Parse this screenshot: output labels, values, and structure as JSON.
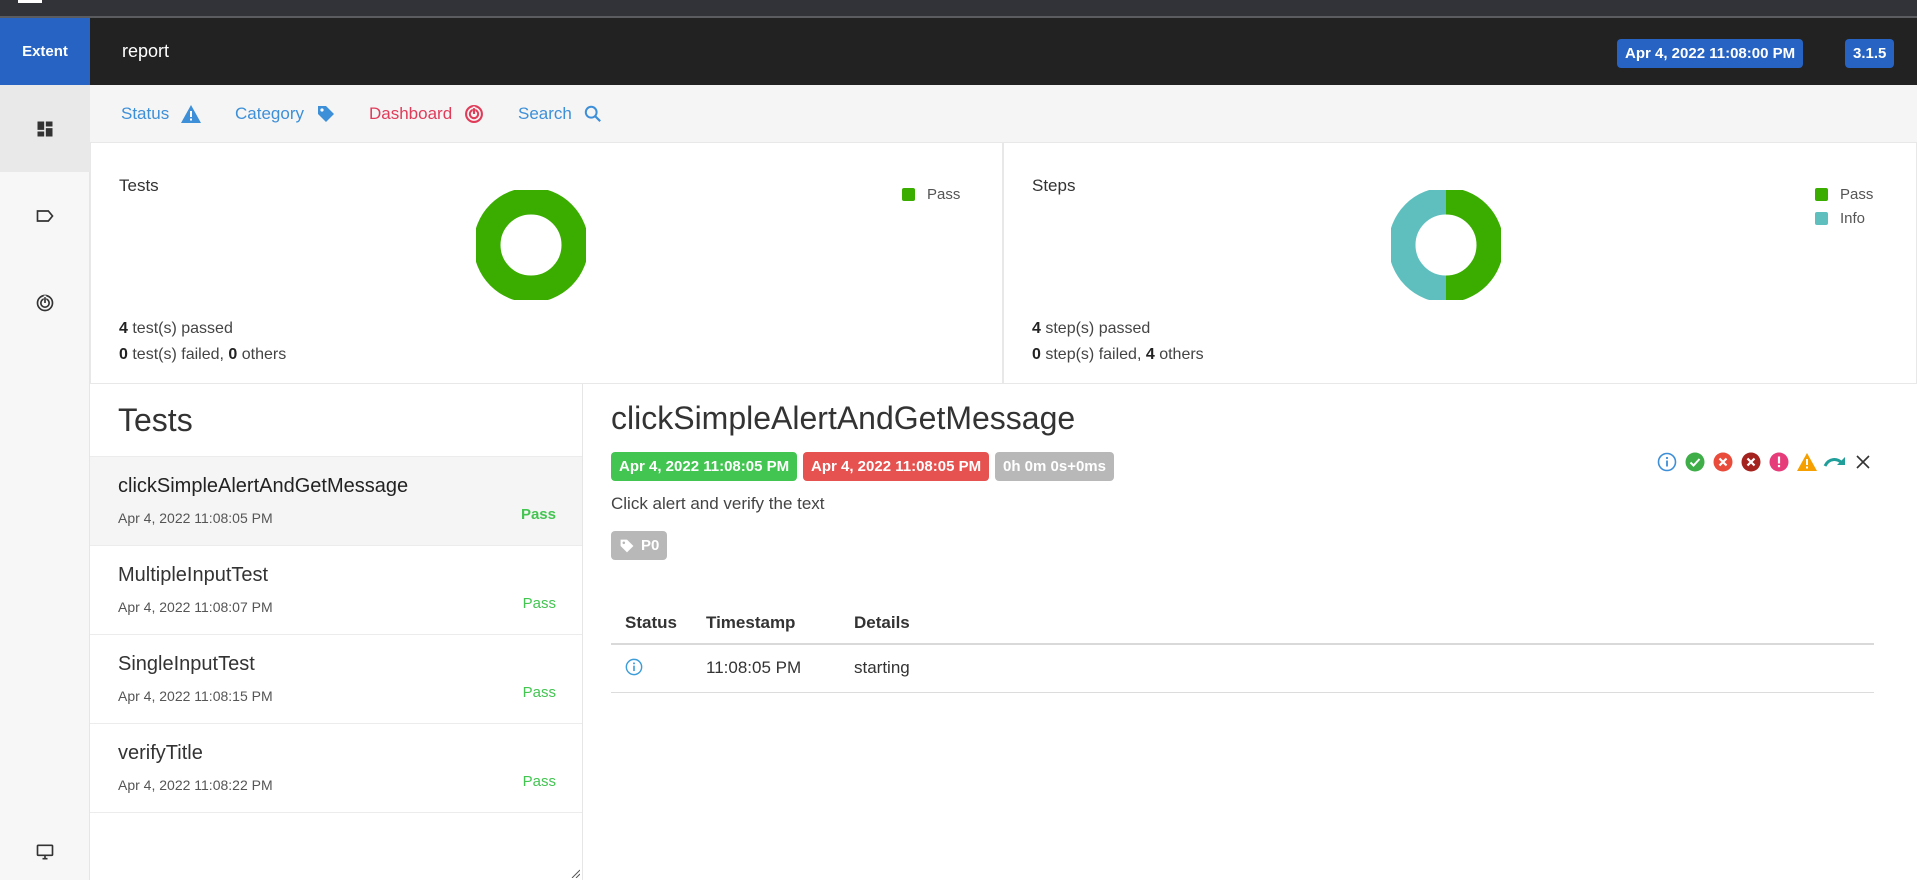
{
  "header": {
    "brand": "Extent",
    "report_name": "report",
    "report_date": "Apr 4, 2022 11:08:00 PM",
    "version": "3.1.5"
  },
  "sidebar": {
    "items": [
      {
        "icon": "dashboard-grid-icon",
        "active": true
      },
      {
        "icon": "tag-outline-icon",
        "active": false
      },
      {
        "icon": "radar-icon",
        "active": false
      },
      {
        "icon": "monitor-icon",
        "active": false
      }
    ]
  },
  "nav": {
    "items": [
      {
        "label": "Status",
        "icon": "warning-triangle-icon"
      },
      {
        "label": "Category",
        "icon": "tag-icon"
      },
      {
        "label": "Dashboard",
        "icon": "radar-icon"
      },
      {
        "label": "Search",
        "icon": "search-icon"
      }
    ]
  },
  "colors": {
    "brand": "#2763c2",
    "pass": "#3aad00",
    "info": "#5fbfbf",
    "link": "#3d8fd8",
    "dashboard_link": "#e03c5a",
    "pass_text": "#44c552",
    "end_badge": "#e5524f",
    "duration_badge": "#b8b8b8"
  },
  "chart_data": [
    {
      "type": "pie",
      "title": "Tests",
      "categories": [
        "Pass"
      ],
      "values": [
        4
      ],
      "legend": [
        "Pass"
      ],
      "legend_position": "top-right",
      "summary": {
        "passed": "4",
        "passed_label": " test(s) passed",
        "failed": "0",
        "failed_label": " test(s) failed, ",
        "others": "0",
        "others_label": " others"
      }
    },
    {
      "type": "pie",
      "title": "Steps",
      "categories": [
        "Pass",
        "Info"
      ],
      "values": [
        4,
        4
      ],
      "legend": [
        "Pass",
        "Info"
      ],
      "legend_position": "top-right",
      "summary": {
        "passed": "4",
        "passed_label": " step(s) passed",
        "failed": "0",
        "failed_label": " step(s) failed, ",
        "others": "4",
        "others_label": " others"
      }
    }
  ],
  "tests_list": {
    "title": "Tests",
    "items": [
      {
        "name": "clickSimpleAlertAndGetMessage",
        "time": "Apr 4, 2022 11:08:05 PM",
        "status": "Pass",
        "active": true
      },
      {
        "name": "MultipleInputTest",
        "time": "Apr 4, 2022 11:08:07 PM",
        "status": "Pass",
        "active": false
      },
      {
        "name": "SingleInputTest",
        "time": "Apr 4, 2022 11:08:15 PM",
        "status": "Pass",
        "active": false
      },
      {
        "name": "verifyTitle",
        "time": "Apr 4, 2022 11:08:22 PM",
        "status": "Pass",
        "active": false
      }
    ]
  },
  "detail": {
    "title": "clickSimpleAlertAndGetMessage",
    "start_time": "Apr 4, 2022 11:08:05 PM",
    "end_time": "Apr 4, 2022 11:08:05 PM",
    "duration": "0h 0m 0s+0ms",
    "description": "Click alert and verify the text",
    "category_tag": "P0",
    "filter_icons": [
      "info-icon",
      "pass-icon",
      "fail-icon",
      "fatal-icon",
      "error-icon",
      "warning-icon",
      "skip-icon",
      "clear-filter-icon"
    ],
    "table": {
      "headers": [
        "Status",
        "Timestamp",
        "Details"
      ],
      "rows": [
        {
          "status_icon": "info-icon",
          "timestamp": "11:08:05 PM",
          "details": "starting"
        }
      ]
    }
  }
}
